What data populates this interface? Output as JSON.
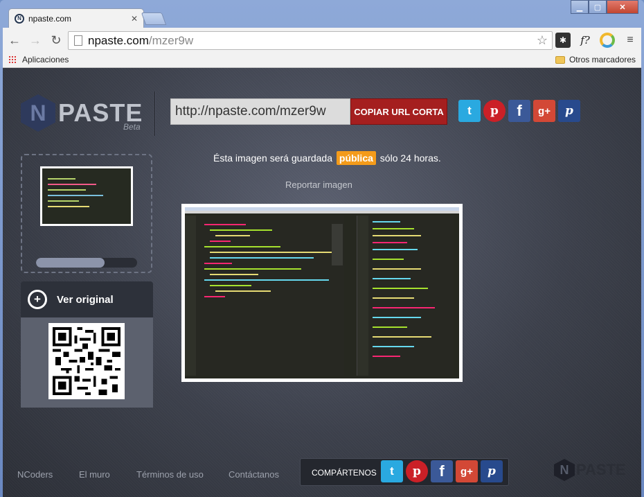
{
  "browser": {
    "tab_title": "npaste.com",
    "url_host": "npaste.com",
    "url_path": "/mzer9w",
    "bookmarks": {
      "apps": "Aplicaciones",
      "other": "Otros marcadores"
    },
    "extensions": [
      "puzzle-icon",
      "function-icon",
      "ring-icon",
      "menu-icon"
    ]
  },
  "header": {
    "logo_text": "PASTE",
    "logo_letter": "N",
    "logo_beta": "Beta",
    "short_url": "http://npaste.com/mzer9w",
    "copy_label": "COPIAR URL CORTA",
    "social": [
      {
        "name": "twitter",
        "glyph": "t"
      },
      {
        "name": "pinterest",
        "glyph": "p"
      },
      {
        "name": "facebook",
        "glyph": "f"
      },
      {
        "name": "google-plus",
        "glyph": "g+"
      },
      {
        "name": "pinboard",
        "glyph": "p"
      }
    ]
  },
  "notice": {
    "before": "Ésta imagen será guardada",
    "badge": "pública",
    "after": "sólo 24 horas."
  },
  "report_label": "Reportar imagen",
  "upload_progress": 0.68,
  "view_original_label": "Ver original",
  "footer": {
    "links": [
      "NCoders",
      "El muro",
      "Términos de uso",
      "Contáctanos"
    ],
    "share_label": "COMPÁRTENOS",
    "logo_letter": "N",
    "logo_text": "PASTE"
  },
  "colors": {
    "copy_button": "#a51f1f",
    "public_badge": "#f49b1a",
    "twitter": "#2aa9e0",
    "pinterest": "#cb2027",
    "facebook": "#3b5998",
    "google_plus": "#d34836"
  }
}
